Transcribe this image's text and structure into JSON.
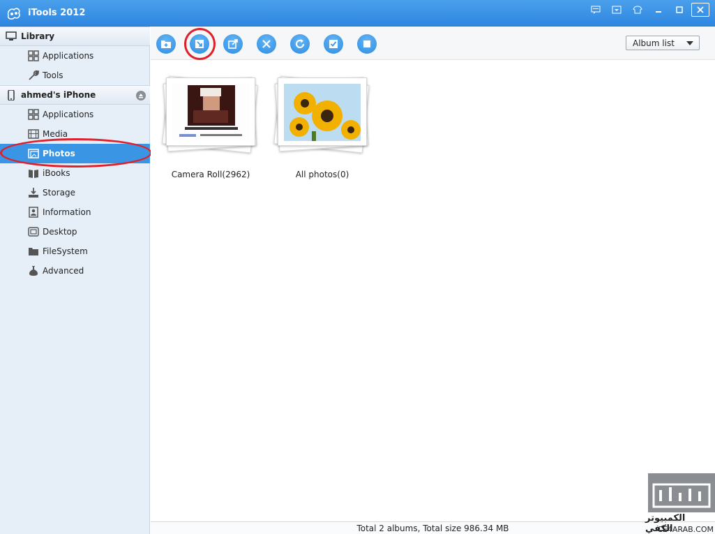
{
  "window": {
    "title": "iTools 2012"
  },
  "colors": {
    "titlebar": "#2e86e0",
    "active": "#3a95e4",
    "annotation": "#e0202a"
  },
  "sidebar": {
    "library": {
      "label": "Library",
      "items": [
        {
          "label": "Applications",
          "icon": "grid-icon"
        },
        {
          "label": "Tools",
          "icon": "wrench-icon"
        }
      ]
    },
    "device": {
      "label": "ahmed's iPhone",
      "items": [
        {
          "label": "Applications",
          "icon": "grid-icon"
        },
        {
          "label": "Media",
          "icon": "film-icon"
        },
        {
          "label": "Photos",
          "icon": "photo-icon",
          "active": true
        },
        {
          "label": "iBooks",
          "icon": "book-icon"
        },
        {
          "label": "Storage",
          "icon": "storage-icon"
        },
        {
          "label": "Information",
          "icon": "info-icon"
        },
        {
          "label": "Desktop",
          "icon": "desktop-icon"
        },
        {
          "label": "FileSystem",
          "icon": "folder-icon"
        },
        {
          "label": "Advanced",
          "icon": "flask-icon"
        }
      ]
    }
  },
  "toolbar": {
    "buttons": [
      "new-album",
      "import",
      "export",
      "delete",
      "refresh",
      "select-all",
      "stop"
    ],
    "view_select": "Album list"
  },
  "albums": [
    {
      "name": "Camera Roll(2962)"
    },
    {
      "name": "All photos(0)"
    }
  ],
  "status": {
    "text": "Total 2 albums, Total size 986.34 MB"
  },
  "watermark": {
    "arabic": "الكمبيوتر الكفي",
    "latin": "CE4ARAB.COM"
  }
}
